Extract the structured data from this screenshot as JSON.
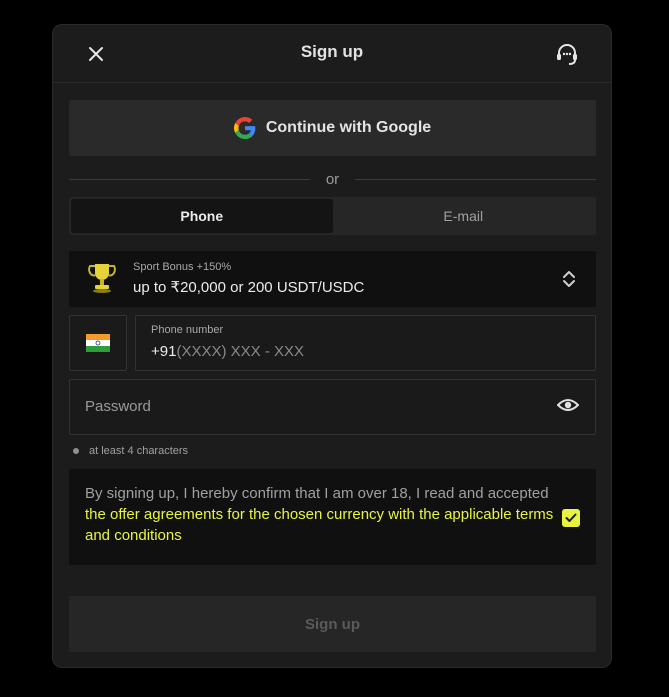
{
  "header": {
    "title": "Sign up",
    "close_icon": "close-icon",
    "support_icon": "headset-icon"
  },
  "google": {
    "label": "Continue with Google",
    "icon": "google-logo-icon"
  },
  "divider": {
    "text": "or"
  },
  "tabs": [
    {
      "label": "Phone",
      "active": true
    },
    {
      "label": "E-mail",
      "active": false
    }
  ],
  "bonus": {
    "icon": "trophy-icon",
    "subtitle": "Sport Bonus +150%",
    "title": "up to ₹20,000 or 200 USDT/USDC",
    "chevron_icon": "chevron-updown-icon"
  },
  "phone": {
    "flag_icon": "india-flag-icon",
    "label": "Phone number",
    "country_code": "+91",
    "placeholder": "(XXXX) XXX - XXX"
  },
  "password": {
    "placeholder": "Password",
    "eye_icon": "eye-icon"
  },
  "hint": {
    "text": "at least 4 characters"
  },
  "terms": {
    "text": "By signing up, I hereby confirm that I am over 18, I read and accepted ",
    "link": "the offer agreements for the chosen currency with the applicable terms and conditions",
    "checked": true
  },
  "submit": {
    "label": "Sign up"
  },
  "colors": {
    "accent": "#e9f53c",
    "background": "#1c1c1c",
    "panel": "#101010"
  }
}
